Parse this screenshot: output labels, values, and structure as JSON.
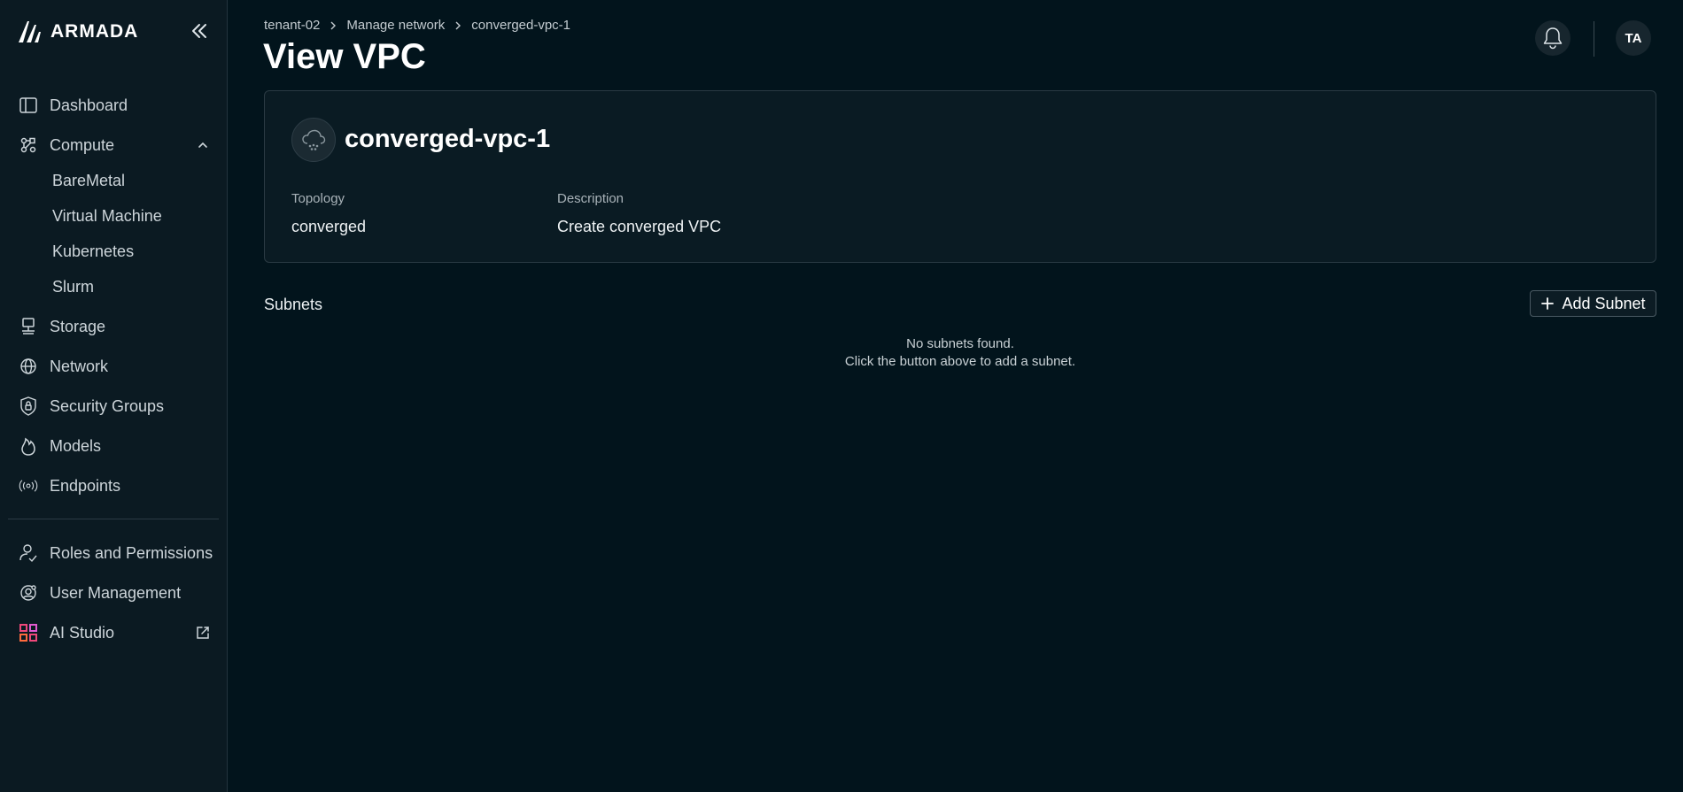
{
  "app": {
    "brand": "ARMADA"
  },
  "sidebar": {
    "items": [
      {
        "label": "Dashboard",
        "icon": "dashboard-icon"
      },
      {
        "label": "Compute",
        "icon": "compute-icon",
        "expanded": true,
        "children": [
          "BareMetal",
          "Virtual Machine",
          "Kubernetes",
          "Slurm"
        ]
      },
      {
        "label": "Storage",
        "icon": "storage-icon"
      },
      {
        "label": "Network",
        "icon": "globe-icon"
      },
      {
        "label": "Security Groups",
        "icon": "shield-lock-icon"
      },
      {
        "label": "Models",
        "icon": "flame-icon"
      },
      {
        "label": "Endpoints",
        "icon": "broadcast-icon"
      }
    ],
    "bottom_items": [
      {
        "label": "Roles and Permissions",
        "icon": "roles-icon"
      },
      {
        "label": "User Management",
        "icon": "user-gear-icon"
      },
      {
        "label": "AI Studio",
        "icon": "grid-apps-icon",
        "external": true
      }
    ]
  },
  "header": {
    "breadcrumb": [
      "tenant-02",
      "Manage network",
      "converged-vpc-1"
    ],
    "title": "View VPC",
    "avatar_initials": "TA"
  },
  "vpc": {
    "name": "converged-vpc-1",
    "topology_label": "Topology",
    "topology_value": "converged",
    "description_label": "Description",
    "description_value": "Create converged VPC"
  },
  "subnets": {
    "title": "Subnets",
    "add_label": "Add Subnet",
    "empty_line1": "No subnets found.",
    "empty_line2": "Click the button above to add a subnet."
  },
  "colors": {
    "background": "#02141c",
    "sidebar": "#0b1a22",
    "card": "#0a1b23"
  }
}
